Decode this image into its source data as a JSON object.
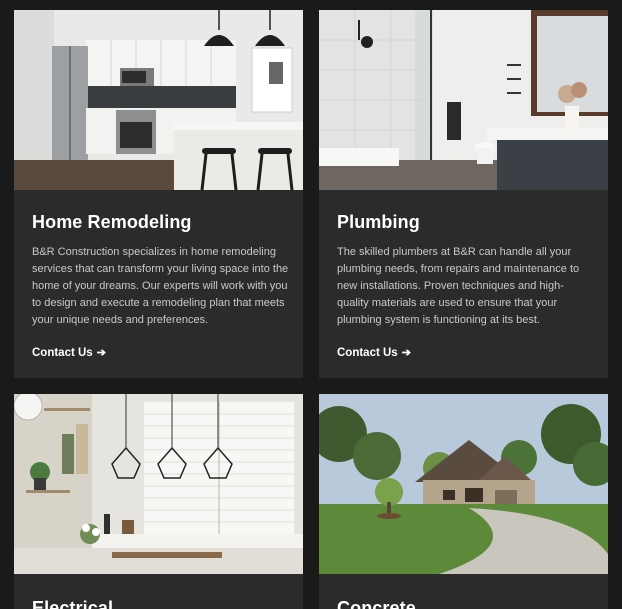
{
  "services": [
    {
      "title": "Home Remodeling",
      "description": "B&R Construction specializes in home remodeling services that can transform your living space into the home of your dreams. Our experts will work with you to design and execute a remodeling plan that meets your unique needs and preferences.",
      "link_label": "Contact Us",
      "image_alt": "modern-kitchen-photo"
    },
    {
      "title": "Plumbing",
      "description": "The skilled plumbers at B&R can handle all your plumbing needs, from repairs and maintenance to new installations. Proven techniques and high-quality materials are used to ensure that your plumbing system is functioning at its best.",
      "link_label": "Contact Us",
      "image_alt": "modern-bathroom-photo"
    },
    {
      "title": "Electrical",
      "image_alt": "pendant-lights-photo"
    },
    {
      "title": "Concrete",
      "image_alt": "house-driveway-photo"
    }
  ],
  "icons": {
    "link_arrow": "arrow-right-icon"
  },
  "colors": {
    "background": "#1a1a1a",
    "card": "#2b2b2b",
    "title": "#ffffff",
    "body_text": "#c9c9c9"
  }
}
